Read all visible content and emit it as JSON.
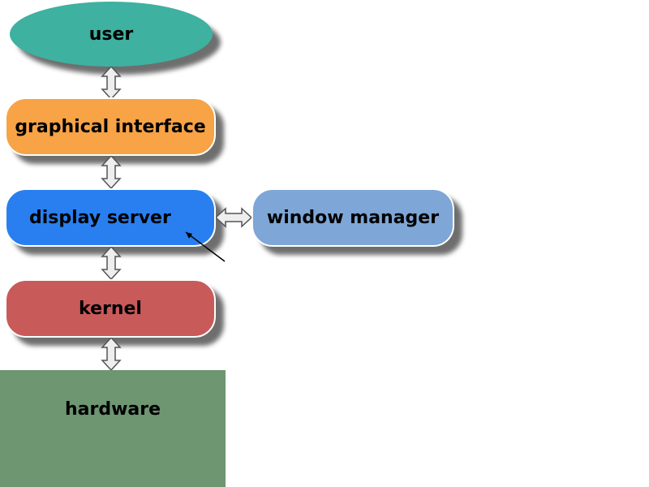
{
  "nodes": {
    "user": {
      "label": "user",
      "color": "#3eb1a0"
    },
    "gui": {
      "label": "graphical interface",
      "color": "#f7a346"
    },
    "display": {
      "label": "display server",
      "color": "#2a7ff0"
    },
    "wm": {
      "label": "window manager",
      "color": "#7ea6d6"
    },
    "kernel": {
      "label": "kernel",
      "color": "#c95a5a"
    },
    "hw": {
      "label": "hardware",
      "color": "#6d9671"
    }
  },
  "connections": [
    {
      "from": "user",
      "to": "gui",
      "bidir": true
    },
    {
      "from": "gui",
      "to": "display",
      "bidir": true
    },
    {
      "from": "display",
      "to": "wm",
      "bidir": true
    },
    {
      "from": "display",
      "to": "kernel",
      "bidir": true
    },
    {
      "from": "kernel",
      "to": "hw",
      "bidir": true
    }
  ]
}
